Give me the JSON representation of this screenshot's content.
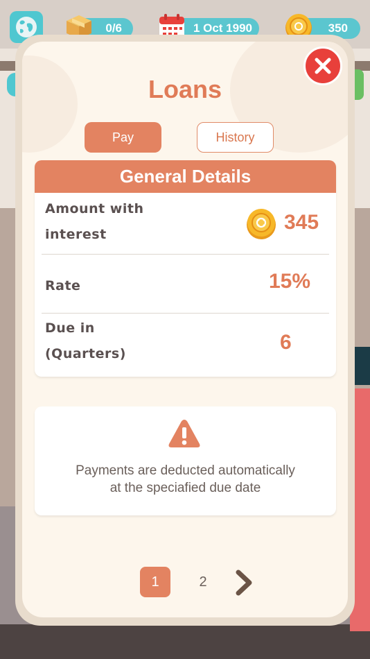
{
  "hud": {
    "inventory_count": "0/6",
    "date": "1 Oct 1990",
    "coins": "350",
    "icons": [
      "globe-icon",
      "box-icon",
      "calendar-icon",
      "coin-icon"
    ]
  },
  "modal": {
    "title": "Loans",
    "tabs": [
      {
        "label": "Pay",
        "active": true
      },
      {
        "label": "History",
        "active": false
      }
    ],
    "details": {
      "header": "General Details",
      "rows": [
        {
          "label_line1": "Amount with",
          "label_line2": "interest",
          "value": "345",
          "icon": "coin-icon"
        },
        {
          "label_line1": "Rate",
          "value": "15%"
        },
        {
          "label_line1": "Due in",
          "label_line2": "(Quarters)",
          "value": "6"
        }
      ]
    },
    "notice": {
      "icon": "warning-icon",
      "line1": "Payments are deducted automatically",
      "line2": "at the speciafied due date"
    },
    "pagination": {
      "pages": [
        "1",
        "2"
      ],
      "current": "1",
      "next_icon": "chevron-right-icon"
    }
  },
  "colors": {
    "accent": "#e38361",
    "title": "#e07b57",
    "close": "#e8403b",
    "hud_pill": "#5bc6cf",
    "panel_bg": "#fdf6ec"
  }
}
